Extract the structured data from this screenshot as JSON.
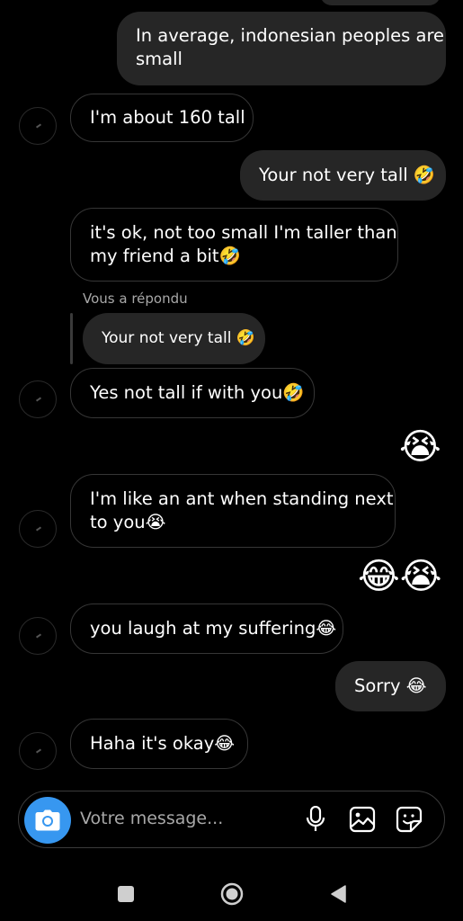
{
  "messages": {
    "m1": {
      "text": "In average, indonesian peoples are small",
      "line1": "In average, indonesian peoples are",
      "line2": "small"
    },
    "m2": {
      "text": "I'm about 160 tall"
    },
    "m3": {
      "text": "Your not very tall 🤣"
    },
    "m4": {
      "line1": "it's ok, not too small I'm taller than",
      "line2": "my friend a bit🤣"
    },
    "reply_label": "Vous a répondu",
    "reply_quote": "Your not very tall 🤣",
    "m5": {
      "text": "Yes not tall if with you🤣"
    },
    "m6": {
      "emoji": "😭"
    },
    "m7": {
      "line1": "I'm like an ant when standing next",
      "line2": "to you😭"
    },
    "m8": {
      "emoji": "😂😭"
    },
    "m9": {
      "text": "you laugh at my suffering😂"
    },
    "m10": {
      "text": "Sorry 😂"
    },
    "m11": {
      "text": "Haha it's okay😂"
    }
  },
  "composer": {
    "placeholder": "Votre message..."
  },
  "icons": {
    "camera": "camera-icon",
    "mic": "microphone-icon",
    "gallery": "gallery-icon",
    "sticker": "sticker-icon",
    "nav_recent": "square-icon",
    "nav_home": "circle-icon",
    "nav_back": "back-triangle-icon"
  },
  "colors": {
    "background": "#000000",
    "sent_bubble": "#262626",
    "received_border": "#363636",
    "accent": "#3797f0",
    "muted_text": "#a8a8a8"
  }
}
